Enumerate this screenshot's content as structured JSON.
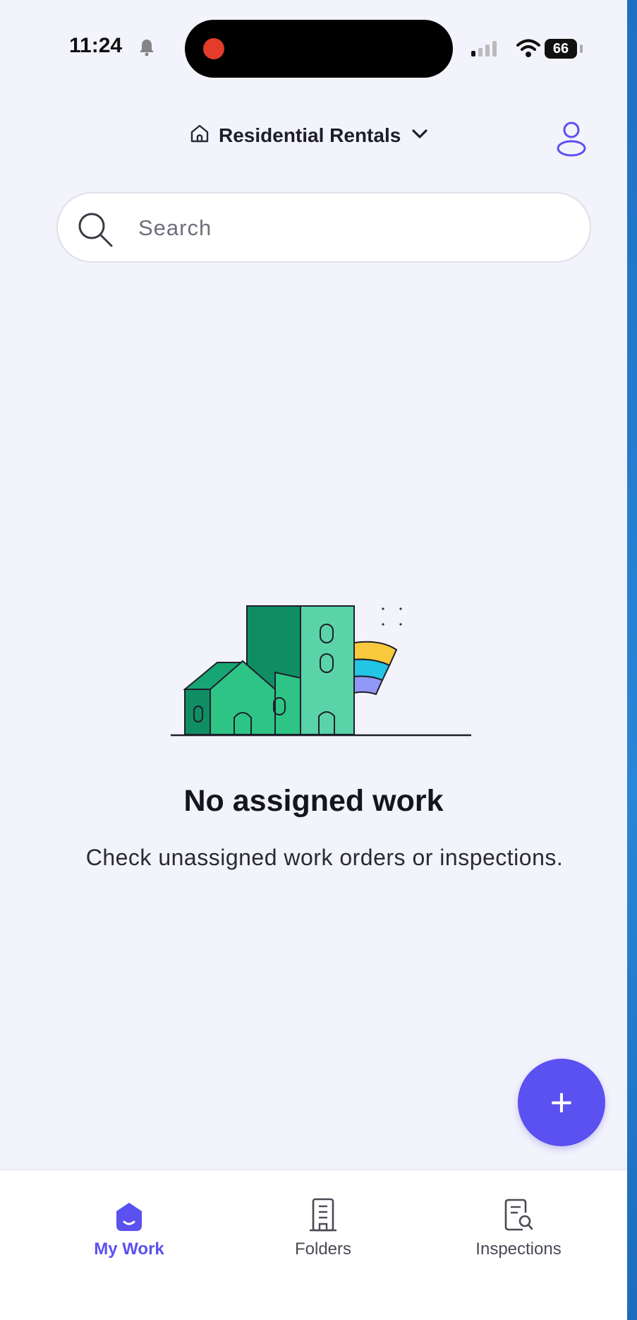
{
  "status_bar": {
    "time": "11:24",
    "battery": "66"
  },
  "header": {
    "location_label": "Residential Rentals"
  },
  "search": {
    "placeholder": "Search"
  },
  "empty_state": {
    "title": "No assigned work",
    "subtitle": "Check unassigned work orders or inspections."
  },
  "fab": {
    "label": "+"
  },
  "bottom_nav": {
    "items": [
      {
        "label": "My Work",
        "icon": "my-work-icon",
        "active": true
      },
      {
        "label": "Folders",
        "icon": "building-icon",
        "active": false
      },
      {
        "label": "Inspections",
        "icon": "inspection-icon",
        "active": false
      }
    ]
  },
  "colors": {
    "accent": "#5b50f0",
    "background": "#f3f3fc"
  }
}
